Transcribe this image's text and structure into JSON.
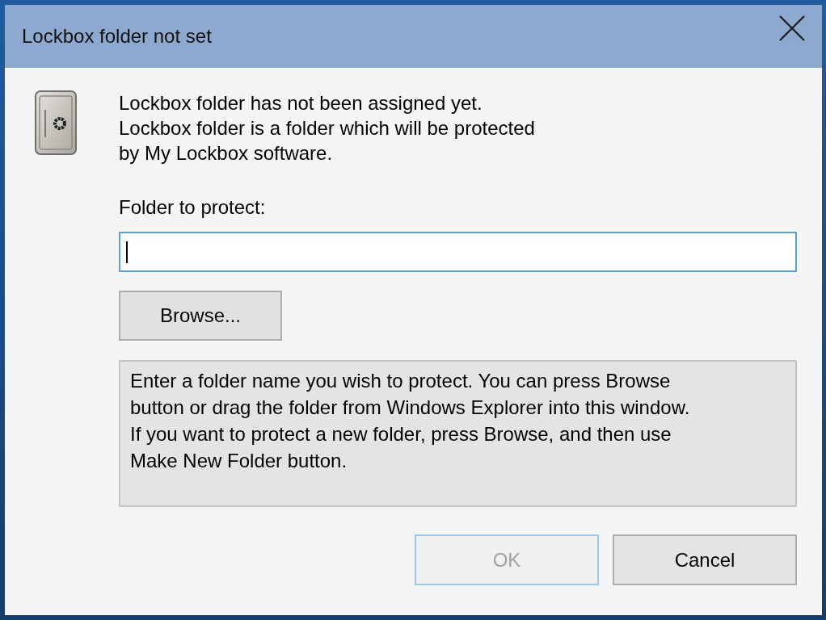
{
  "window": {
    "title": "Lockbox folder not set"
  },
  "message_lines": [
    "Lockbox folder has not been assigned yet.",
    "Lockbox folder is a folder which will be protected",
    "by My Lockbox software."
  ],
  "folder_field": {
    "label": "Folder to protect:",
    "focused": true
  },
  "browse_button": {
    "label": "Browse..."
  },
  "hint_lines": [
    "Enter a folder name you wish to protect. You can press Browse",
    "button or drag the folder from Windows Explorer into this window.",
    "If you want to protect a new folder, press Browse, and then use",
    "Make New Folder button."
  ],
  "buttons": [
    {
      "label": "OK",
      "disabled": true,
      "default": true
    },
    {
      "label": "Cancel",
      "disabled": false,
      "default": false
    }
  ]
}
